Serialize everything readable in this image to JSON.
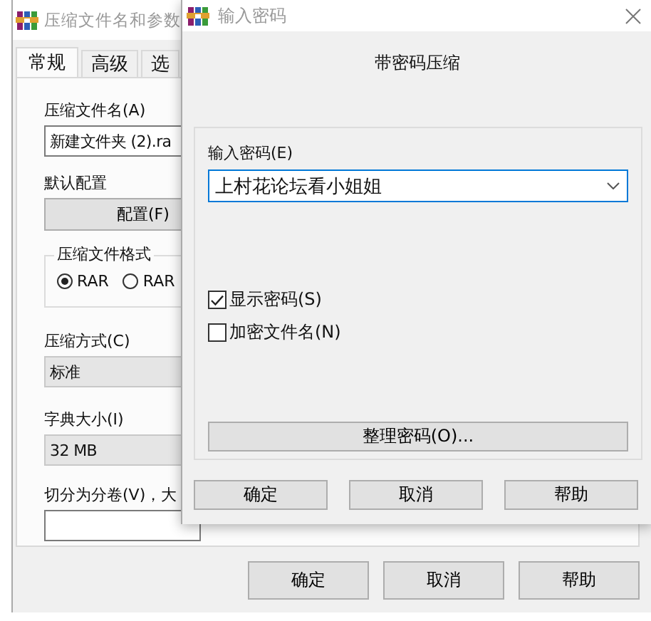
{
  "main_window": {
    "title": "压缩文件名和参数",
    "tabs": [
      {
        "label": "常规",
        "selected": true
      },
      {
        "label": "高级",
        "selected": false
      },
      {
        "label": "选",
        "selected": false
      }
    ],
    "archive_name": {
      "label": "压缩文件名(A)",
      "value": "新建文件夹 (2).ra"
    },
    "default_profile": {
      "label": "默认配置",
      "button": "配置(F)"
    },
    "archive_format": {
      "label": "压缩文件格式",
      "options": [
        {
          "label": "RAR",
          "selected": true
        },
        {
          "label": "RAR",
          "selected": false
        }
      ]
    },
    "compression_method": {
      "label": "压缩方式(C)",
      "value": "标准"
    },
    "dictionary_size": {
      "label": "字典大小(I)",
      "value": "32 MB"
    },
    "split_volumes": {
      "label": "切分为分卷(V)，大"
    },
    "buttons": [
      "确定",
      "取消",
      "帮助"
    ]
  },
  "password_dialog": {
    "title": "输入密码",
    "heading": "带密码压缩",
    "password": {
      "label": "输入密码(E)",
      "value": "上村花论坛看小姐姐"
    },
    "options": [
      {
        "label": "显示密码(S)",
        "checked": true
      },
      {
        "label": "加密文件名(N)",
        "checked": false
      }
    ],
    "organize_button": "整理密码(O)...",
    "buttons": [
      "确定",
      "取消",
      "帮助"
    ]
  }
}
